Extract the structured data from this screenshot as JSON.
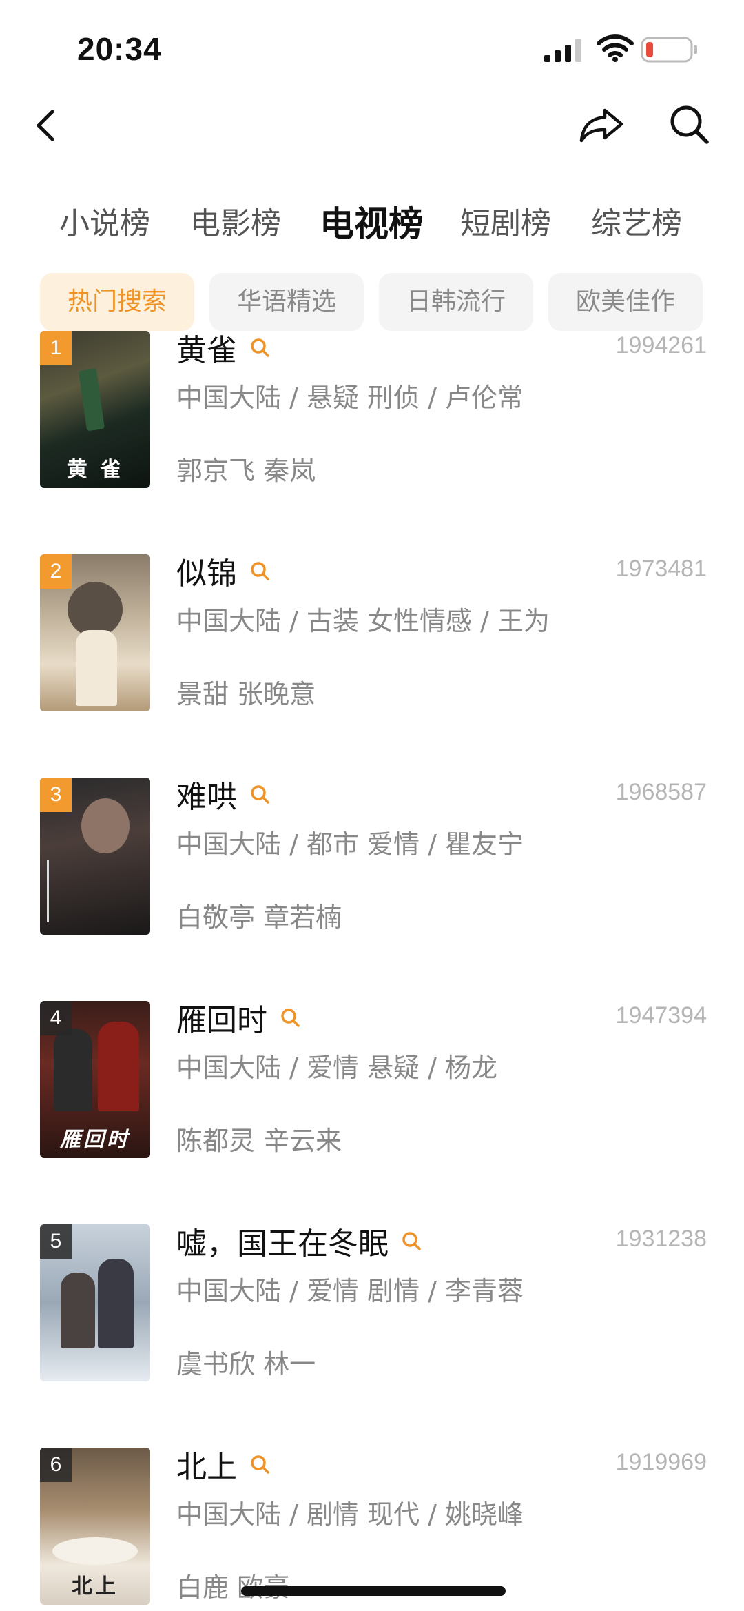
{
  "status": {
    "time": "20:34"
  },
  "categories": [
    {
      "label": "小说榜",
      "active": false
    },
    {
      "label": "电影榜",
      "active": false
    },
    {
      "label": "电视榜",
      "active": true
    },
    {
      "label": "短剧榜",
      "active": false
    },
    {
      "label": "综艺榜",
      "active": false
    }
  ],
  "filters": [
    {
      "label": "热门搜索",
      "active": true
    },
    {
      "label": "华语精选",
      "active": false
    },
    {
      "label": "日韩流行",
      "active": false
    },
    {
      "label": "欧美佳作",
      "active": false
    }
  ],
  "colors": {
    "accent": "#ef9326",
    "rank_badge": "#f29a2e"
  },
  "items": [
    {
      "rank": "1",
      "title": "黄雀",
      "score": "1994261",
      "meta": "中国大陆 / 悬疑 刑侦 / 卢伦常",
      "cast": "郭京飞 秦岚",
      "poster_text": "黄 雀"
    },
    {
      "rank": "2",
      "title": "似锦",
      "score": "1973481",
      "meta": "中国大陆 / 古装 女性情感 / 王为",
      "cast": "景甜 张晚意",
      "poster_text": ""
    },
    {
      "rank": "3",
      "title": "难哄",
      "score": "1968587",
      "meta": "中国大陆 / 都市 爱情 / 瞿友宁",
      "cast": "白敬亭 章若楠",
      "poster_text": ""
    },
    {
      "rank": "4",
      "title": "雁回时",
      "score": "1947394",
      "meta": "中国大陆 / 爱情 悬疑 / 杨龙",
      "cast": "陈都灵 辛云来",
      "poster_text": "雁回时"
    },
    {
      "rank": "5",
      "title": "嘘，国王在冬眠",
      "score": "1931238",
      "meta": "中国大陆 / 爱情 剧情 / 李青蓉",
      "cast": "虞书欣 林一",
      "poster_text": ""
    },
    {
      "rank": "6",
      "title": "北上",
      "score": "1919969",
      "meta": "中国大陆 / 剧情 现代 / 姚晓峰",
      "cast": "白鹿 欧豪",
      "poster_text": "北上"
    }
  ]
}
